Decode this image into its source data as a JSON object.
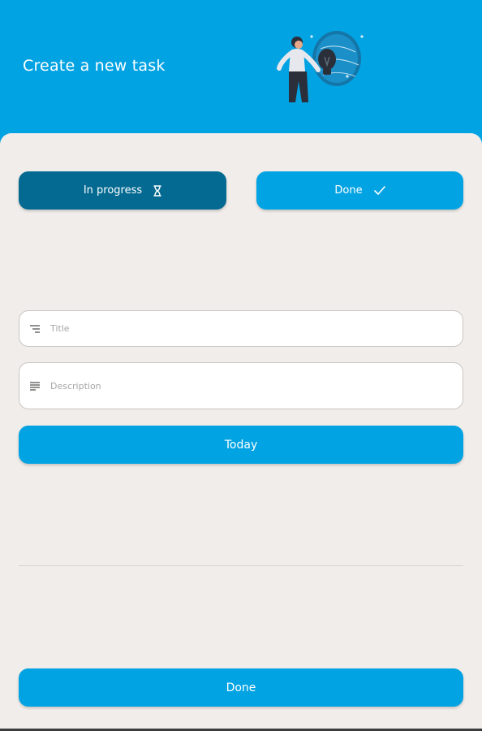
{
  "header": {
    "title": "Create a new task",
    "background_color": "#02a3e3"
  },
  "illustration": {
    "icon": "woman-with-lightbulb-illustration"
  },
  "status_toggle": {
    "in_progress_label": "In progress",
    "in_progress_icon": "hourglass-icon",
    "in_progress_color": "#046a91",
    "done_label": "Done",
    "done_icon": "check-icon",
    "done_color": "#02a3e3",
    "selected": "In progress"
  },
  "form": {
    "title_placeholder": "Title",
    "title_value": "",
    "title_icon": "short-text-icon",
    "description_placeholder": "Description",
    "description_value": "",
    "description_icon": "notes-icon",
    "date_button_label": "Today"
  },
  "footer": {
    "submit_label": "Done"
  },
  "colors": {
    "sheet_background": "#f0edea",
    "accent": "#02a3e3"
  }
}
